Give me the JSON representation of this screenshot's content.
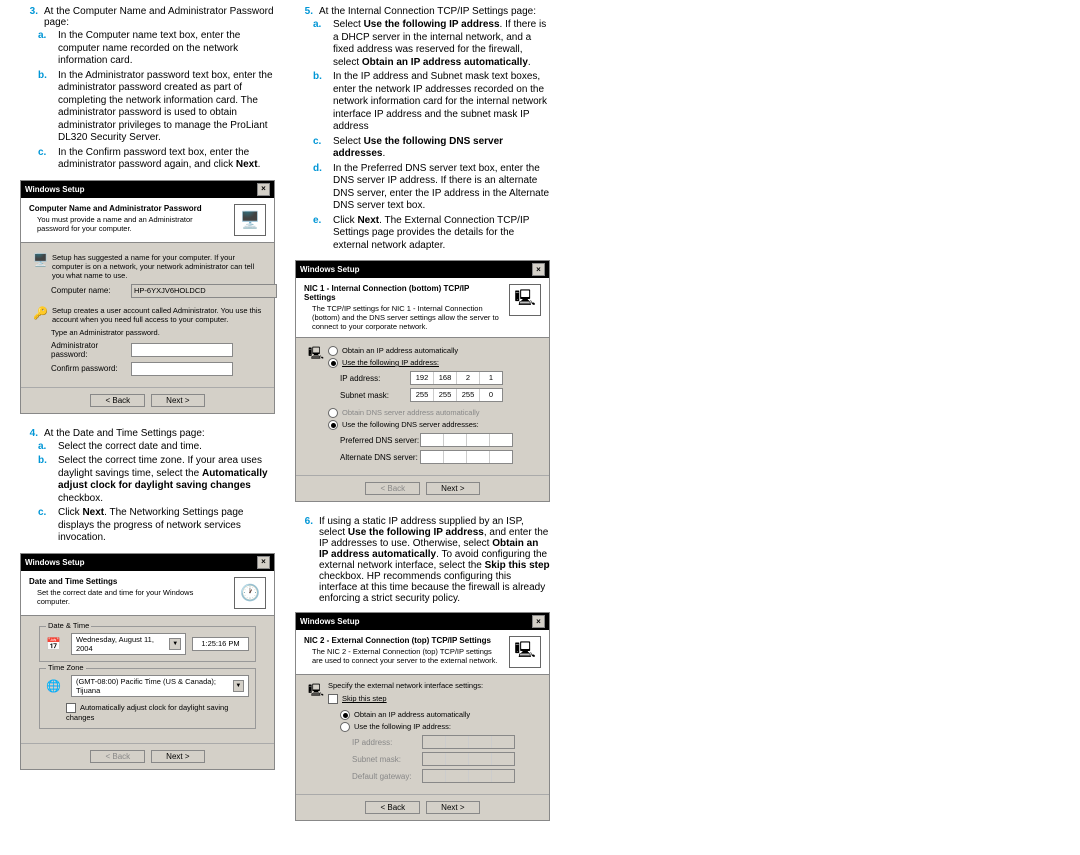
{
  "col1": {
    "step3": {
      "num": "3.",
      "text": "At the Computer Name and Administrator Password page:",
      "a": "In the Computer name text box, enter the computer name recorded on the network information card.",
      "b": "In the Administrator password text box, enter the administrator password created as part of completing the network information card. The administrator password is used to obtain administrator privileges to manage the ProLiant DL320 Security Server.",
      "c_pre": "In the Confirm password text box, enter the administrator password again, and click ",
      "c_bold": "Next",
      "c_post": "."
    },
    "dlg1": {
      "win_title": "Windows Setup",
      "hdr_title": "Computer Name and Administrator Password",
      "hdr_sub": "You must provide a name and an Administrator password for your computer.",
      "l1": "Setup has suggested a name for your computer. If your computer is on a network, your network administrator can tell you what name to use.",
      "comp_label": "Computer name:",
      "comp_val": "HP-6YXJV6HOLDCD",
      "l2": "Setup creates a user account called Administrator. You use this account when you need full access to your computer.",
      "l3": "Type an Administrator password.",
      "admin_label": "Administrator password:",
      "confirm_label": "Confirm password:",
      "back": "< Back",
      "next": "Next >"
    },
    "step4": {
      "num": "4.",
      "text": "At the Date and Time Settings page:",
      "a": "Select the correct date and time.",
      "b_pre": "Select the correct time zone. If your area uses daylight savings time, select the ",
      "b_bold": "Automatically adjust clock for daylight saving changes",
      "b_post": " checkbox.",
      "c_pre": "Click ",
      "c_bold": "Next",
      "c_post": ". The Networking Settings page displays the progress of network services invocation."
    },
    "dlg2": {
      "win_title": "Windows Setup",
      "hdr_title": "Date and Time Settings",
      "hdr_sub": "Set the correct date and time for your Windows computer.",
      "grp1": "Date & Time",
      "date_val": "Wednesday, August 11, 2004",
      "time_val": "1:25:16 PM",
      "grp2": "Time Zone",
      "tz_val": "(GMT-08:00) Pacific Time (US & Canada); Tijuana",
      "chk_label": "Automatically adjust clock for daylight saving changes",
      "back": "< Back",
      "next": "Next >"
    }
  },
  "col2": {
    "step5": {
      "num": "5.",
      "text": "At the Internal Connection TCP/IP Settings page:",
      "a_pre": "Select ",
      "a_b1": "Use the following IP address",
      "a_mid": ". If there is a DHCP server in the internal network, and a fixed address was reserved for the firewall, select ",
      "a_b2": "Obtain an IP address automatically",
      "a_post": ".",
      "b": "In the IP address and Subnet mask text boxes, enter the network IP addresses recorded on the network information card for the internal network interface IP address and the subnet mask IP address",
      "c_pre": "Select ",
      "c_bold": "Use the following DNS server addresses",
      "c_post": ".",
      "d": "In the Preferred DNS server text box, enter the DNS server IP address. If there is an alternate DNS server, enter the IP address in the Alternate DNS server text box.",
      "e_pre": "Click ",
      "e_bold": "Next",
      "e_post": ". The External Connection TCP/IP Settings page provides the details for the external network adapter."
    },
    "dlg3": {
      "win_title": "Windows Setup",
      "hdr_title": "NIC 1 - Internal Connection (bottom) TCP/IP Settings",
      "hdr_sub": "The TCP/IP settings for NIC 1 - Internal Connection (bottom) and the DNS server settings allow the server to connect to your corporate network.",
      "r1": "Obtain an IP address automatically",
      "r2": "Use the following IP address:",
      "ip_label": "IP address:",
      "ip_val": [
        "192",
        "168",
        "2",
        "1"
      ],
      "sub_label": "Subnet mask:",
      "sub_val": [
        "255",
        "255",
        "255",
        "0"
      ],
      "r3": "Obtain DNS server address automatically",
      "r4": "Use the following DNS server addresses:",
      "pdns_label": "Preferred DNS server:",
      "adns_label": "Alternate DNS server:",
      "back": "< Back",
      "next": "Next >"
    },
    "step6": {
      "num": "6.",
      "p_pre": "If using a static IP address supplied by an ISP, select ",
      "p_b1": "Use the following IP address",
      "p_m1": ", and enter the IP addresses to use. Otherwise, select ",
      "p_b2": "Obtain an IP address automatically",
      "p_m2": ". To avoid configuring the external network interface, select the ",
      "p_b3": "Skip this step",
      "p_post": " checkbox. HP recommends configuring this interface at this time because the firewall is already enforcing a strict security policy."
    },
    "dlg4": {
      "win_title": "Windows Setup",
      "hdr_title": "NIC 2 - External Connection (top) TCP/IP Settings",
      "hdr_sub": "The NIC 2 - External Connection (top) TCP/IP settings are used to connect your server to the external network.",
      "l1": "Specify the external network interface settings:",
      "skip": "Skip this step",
      "r1": "Obtain an IP address automatically",
      "r2": "Use the following IP address:",
      "f1": "IP address:",
      "f2": "Subnet mask:",
      "f3": "Default gateway:",
      "back": "< Back",
      "next": "Next >"
    }
  }
}
